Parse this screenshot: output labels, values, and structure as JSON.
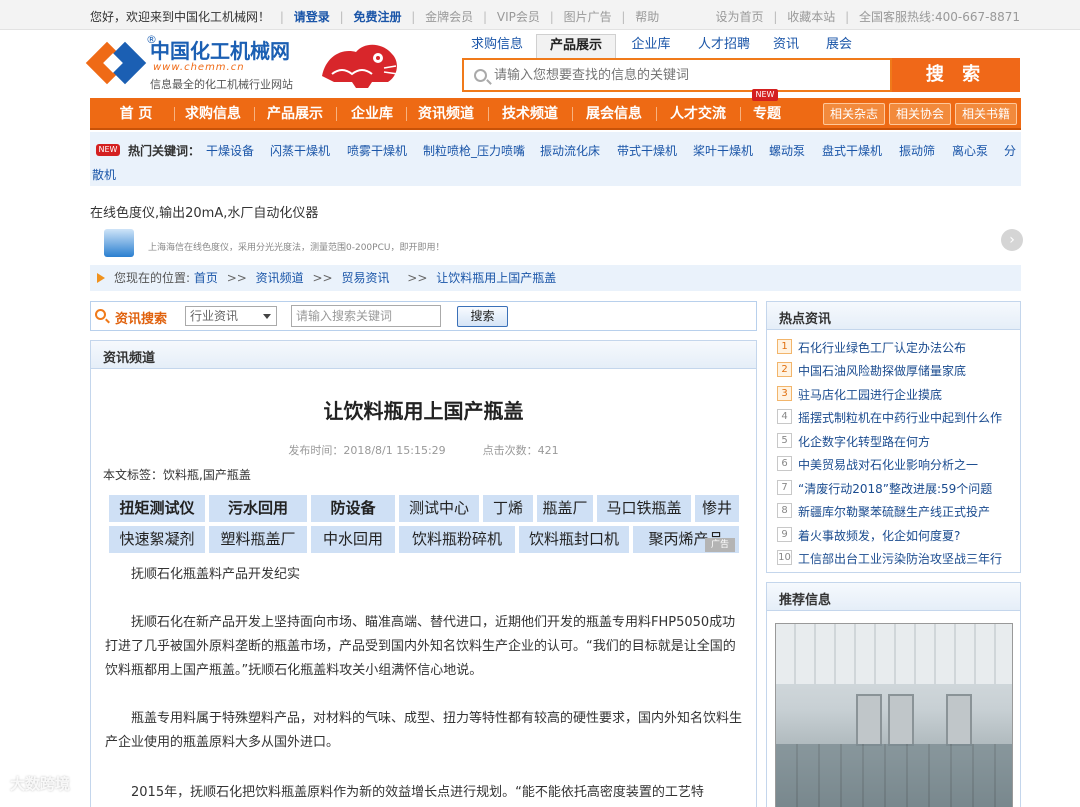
{
  "topbar": {
    "welcome": "您好，欢迎来到中国化工机械网！",
    "login": "请登录",
    "register": "免费注册",
    "links": [
      "金牌会员",
      "VIP会员",
      "图片广告",
      "帮助"
    ],
    "right_links": [
      "设为首页",
      "收藏本站"
    ],
    "hotline": "全国客服热线:400-667-8871"
  },
  "header": {
    "logo_title": "中国化工机械网",
    "logo_reg": "®",
    "logo_domain": "www.chemm.cn",
    "logo_tagline": "信息最全的化工机械行业网站",
    "search_tabs": [
      "求购信息",
      "产品展示",
      "企业库",
      "人才招聘",
      "资讯",
      "展会"
    ],
    "active_tab": "产品展示",
    "search_placeholder": "请输入您想要查找的信息的关键词",
    "search_button": "搜 索"
  },
  "mainnav": {
    "items": [
      "首 页",
      "求购信息",
      "产品展示",
      "企业库",
      "资讯频道",
      "技术频道",
      "展会信息",
      "人才交流",
      "专题"
    ],
    "new_tag": "NEW",
    "sub_buttons": [
      "相关杂志",
      "相关协会",
      "相关书籍"
    ]
  },
  "hotbar": {
    "badge": "NEW",
    "label": "热门关键词：",
    "keywords": [
      "干燥设备",
      "闪蒸干燥机",
      "喷雾干燥机",
      "制粒喷枪_压力喷嘴",
      "振动流化床",
      "带式干燥机",
      "桨叶干燥机",
      "螺动泵",
      "盘式干燥机",
      "振动筛",
      "离心泵",
      "分"
    ],
    "keywords_wrap": "散机"
  },
  "ad": {
    "title": "在线色度仪,输出20mA,水厂自动化仪器",
    "desc": "上海海信在线色度仪，采用分光光度法，测量范围0-200PCU，即开即用！",
    "next_icon": "chevron-right-icon"
  },
  "breadcrumb": {
    "prefix": "您现在的位置:",
    "items": [
      "首页",
      "资讯频道",
      "贸易资讯",
      "让饮料瓶用上国产瓶盖"
    ],
    "separator": ">>"
  },
  "news_search": {
    "label": "资讯搜索",
    "select_value": "行业资讯",
    "input_placeholder": "请输入搜索关键词",
    "button": "搜索"
  },
  "article": {
    "section": "资讯频道",
    "title": "让饮料瓶用上国产瓶盖",
    "publish_time": "发布时间：2018/8/1 15:15:29",
    "click_count": "点击次数：421",
    "tags": "本文标签：饮料瓶,国产瓶盖",
    "keyword_grid": [
      [
        "扭矩测试仪",
        "污水回用",
        "防设备",
        "测试中心",
        "丁烯",
        "瓶盖厂",
        "马口铁瓶盖",
        "惨井"
      ],
      [
        "快速絮凝剂",
        "塑料瓶盖厂",
        "中水回用",
        "饮料瓶粉碎机",
        "饮料瓶封口机",
        "聚丙烯产品"
      ]
    ],
    "ad_tag": "广告",
    "paragraphs": [
      "抚顺石化瓶盖料产品开发纪实",
      "抚顺石化在新产品开发上坚持面向市场、瞄准高端、替代进口，近期他们开发的瓶盖专用料FHP5050成功打进了几乎被国外原料垄断的瓶盖市场，产品受到国内外知名饮料生产企业的认可。“我们的目标就是让全国的饮料瓶都用上国产瓶盖。”抚顺石化瓶盖料攻关小组满怀信心地说。",
      "瓶盖专用料属于特殊塑料产品，对材料的气味、成型、扭力等特性都有较高的硬性要求，国内外知名饮料生产企业使用的瓶盖原料大多从国外进口。",
      "2015年，抚顺石化把饮料瓶盖原料作为新的效益增长点进行规划。“能不能依托高密度装置的工艺特"
    ]
  },
  "hot_news": {
    "title": "热点资讯",
    "items": [
      "石化行业绿色工厂认定办法公布",
      "中国石油风险勘探做厚储量家底",
      "驻马店化工园进行企业摸底",
      "摇摆式制粒机在中药行业中起到什么作",
      "化企数字化转型路在何方",
      "中美贸易战对石化业影响分析之一",
      "“清废行动2018”整改进展:59个问题",
      "新疆库尔勒聚苯硫醚生产线正式投产",
      "着火事故频发，化企如何度夏?",
      "工信部出台工业污染防治攻坚战三年行"
    ]
  },
  "recommend": {
    "title": "推荐信息"
  },
  "watermark": "大数跨境"
}
